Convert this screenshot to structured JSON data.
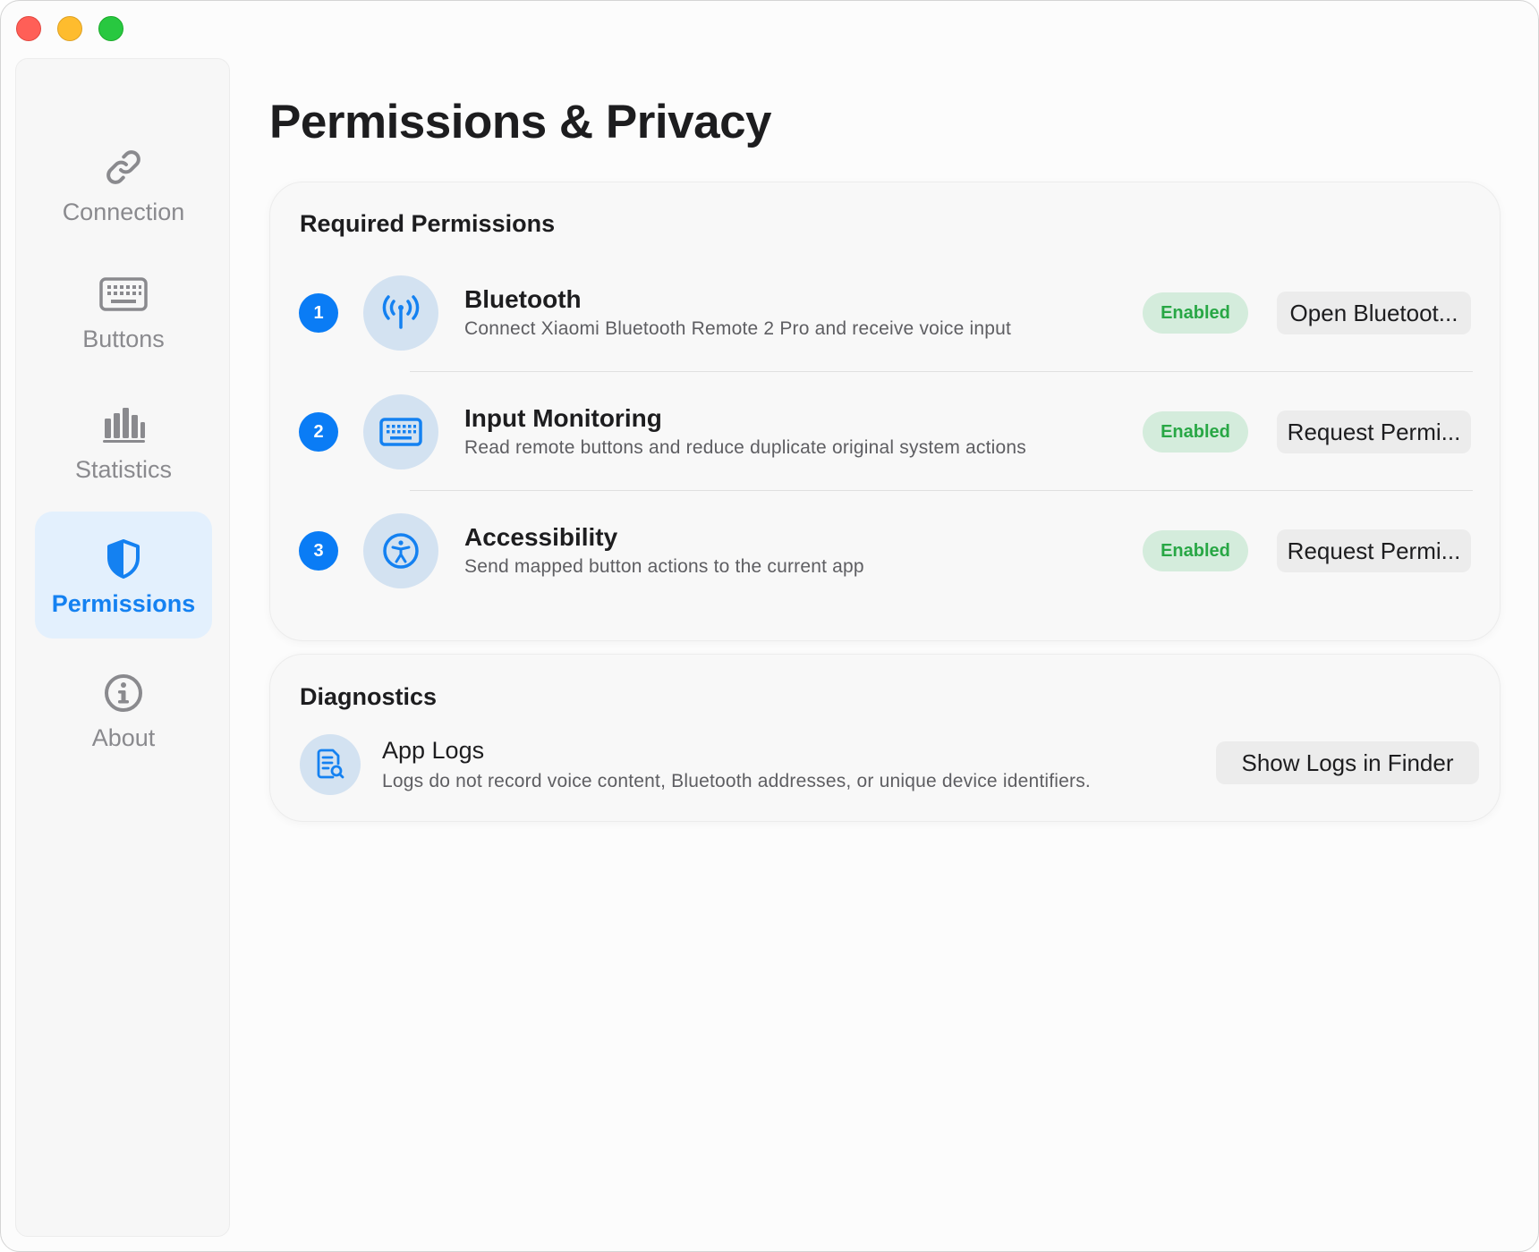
{
  "window": {
    "controls": [
      "close",
      "minimize",
      "zoom"
    ]
  },
  "sidebar": {
    "items": [
      {
        "label": "Connection",
        "icon": "link-icon",
        "active": false
      },
      {
        "label": "Buttons",
        "icon": "keyboard-icon",
        "active": false
      },
      {
        "label": "Statistics",
        "icon": "bar-chart-icon",
        "active": false
      },
      {
        "label": "Permissions",
        "icon": "shield-icon",
        "active": true
      },
      {
        "label": "About",
        "icon": "info-icon",
        "active": false
      }
    ]
  },
  "main": {
    "title": "Permissions & Privacy",
    "required": {
      "title": "Required Permissions",
      "items": [
        {
          "number": "1",
          "icon": "antenna-icon",
          "name": "Bluetooth",
          "description": "Connect Xiaomi Bluetooth Remote 2 Pro and receive voice input",
          "status": "Enabled",
          "action": "Open Bluetoot..."
        },
        {
          "number": "2",
          "icon": "keyboard-icon",
          "name": "Input Monitoring",
          "description": "Read remote buttons and reduce duplicate original system actions",
          "status": "Enabled",
          "action": "Request Permi..."
        },
        {
          "number": "3",
          "icon": "accessibility-icon",
          "name": "Accessibility",
          "description": "Send mapped button actions to the current app",
          "status": "Enabled",
          "action": "Request Permi..."
        }
      ]
    },
    "diagnostics": {
      "title": "Diagnostics",
      "item": {
        "icon": "document-search-icon",
        "name": "App Logs",
        "description": "Logs do not record voice content, Bluetooth addresses, or unique device identifiers.",
        "action": "Show Logs in Finder"
      }
    }
  },
  "colors": {
    "accent": "#0a7cf5",
    "active_nav_bg": "#e3f0fd",
    "status_badge_bg": "#d4ecdc",
    "status_badge_text": "#28a745",
    "icon_circle_bg": "#d3e2f1"
  }
}
